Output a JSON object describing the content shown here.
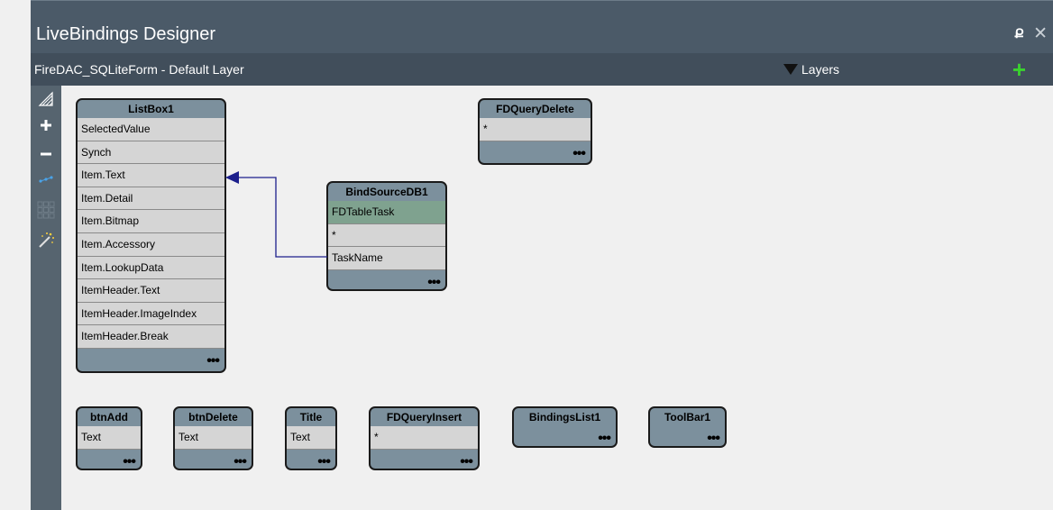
{
  "window": {
    "title": "LiveBindings Designer",
    "pin_glyph": "Ք",
    "close_glyph": "✕"
  },
  "subbar": {
    "caption": "FireDAC_SQLiteForm  - Default Layer",
    "layers_label": "Layers",
    "add_glyph": "+"
  },
  "toolbar": {
    "icons": [
      "zoom-fit-icon",
      "zoom-in-icon",
      "zoom-out-icon",
      "link-icon",
      "grid-icon",
      "magic-wand-icon"
    ]
  },
  "nodes": {
    "listbox1": {
      "title": "ListBox1",
      "rows": [
        "SelectedValue",
        "Synch",
        "Item.Text",
        "Item.Detail",
        "Item.Bitmap",
        "Item.Accessory",
        "Item.LookupData",
        "ItemHeader.Text",
        "ItemHeader.ImageIndex",
        "ItemHeader.Break"
      ]
    },
    "fdquerydelete": {
      "title": "FDQueryDelete",
      "rows": [
        "*"
      ]
    },
    "bindsourcedb1": {
      "title": "BindSourceDB1",
      "rows": [
        "FDTableTask",
        "*",
        "TaskName"
      ]
    },
    "btnadd": {
      "title": "btnAdd",
      "rows": [
        "Text"
      ]
    },
    "btndelete": {
      "title": "btnDelete",
      "rows": [
        "Text"
      ]
    },
    "title": {
      "title": "Title",
      "rows": [
        "Text"
      ]
    },
    "fdqueryinsert": {
      "title": "FDQueryInsert",
      "rows": [
        "*"
      ]
    },
    "bindingslist1": {
      "title": "BindingsList1",
      "rows": []
    },
    "toolbar1": {
      "title": "ToolBar1",
      "rows": []
    }
  },
  "more_glyph": "•••",
  "colors": {
    "title_bar": "#4b5a68",
    "sub_bar": "#414e5b",
    "node_fill": "#7c909d",
    "row_fill": "#d5d5d5",
    "selected_row": "#7fa28f",
    "link_line": "#1c1f8c",
    "add_green": "#3ad12f"
  }
}
